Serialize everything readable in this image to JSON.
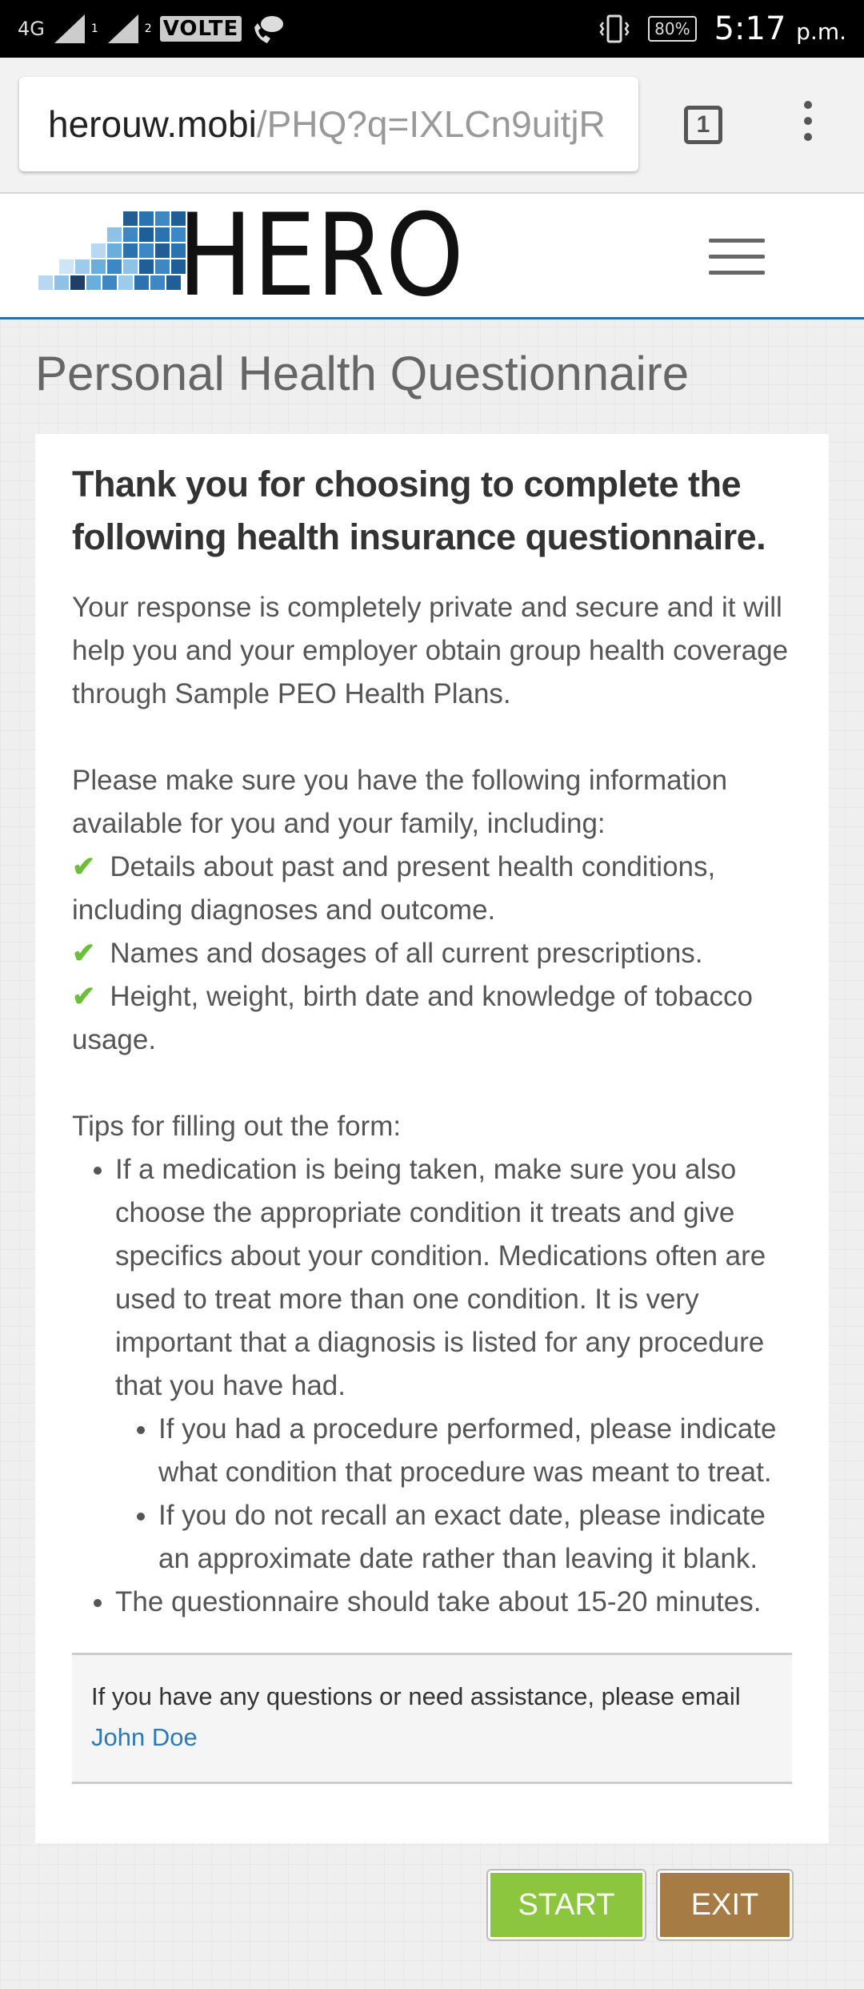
{
  "status_bar": {
    "network": "4G",
    "sim1": "1",
    "sim2": "2",
    "volte": "VOLTE",
    "battery": "80%",
    "time": "5:17",
    "ampm": "p.m."
  },
  "browser": {
    "url_host": "herouw.mobi",
    "url_path": "/PHQ?q=IXLCn9uitjR",
    "tab_count": "1"
  },
  "site": {
    "logo_text": "HERO",
    "brand_color": "#2e6da4"
  },
  "page": {
    "title": "Personal Health Questionnaire"
  },
  "card": {
    "heading": "Thank you for choosing to complete the following health insurance questionnaire.",
    "privacy_text": "Your response is completely private and secure and it will help you and your employer obtain group health coverage through Sample PEO Health Plans.",
    "info_intro": "Please make sure you have the following information available for you and your family, including:",
    "checklist": [
      "Details about past and present health conditions, including diagnoses and outcome.",
      "Names and dosages of all current prescriptions.",
      "Height, weight, birth date and knowledge of tobacco usage."
    ],
    "tips_intro": "Tips for filling out the form:",
    "tips": [
      "If a medication is being taken, make sure you also choose the appropriate condition it treats and give specifics about your condition. Medications often are used to treat more than one condition. It is very important that a diagnosis is listed for any procedure that you have had.",
      "The questionnaire should take about 15-20 minutes."
    ],
    "sub_tips": [
      "If you had a procedure performed, please indicate what condition that procedure was meant to treat.",
      "If you do not recall an exact date, please indicate an approximate date rather than leaving it blank."
    ],
    "help_text": "If you have any questions or need assistance, please email ",
    "help_link": "John Doe"
  },
  "buttons": {
    "start": "START",
    "exit": "EXIT",
    "start_color": "#8cc63f",
    "exit_color": "#a67b44"
  },
  "icons": [
    "signal-icon",
    "vibrate-icon",
    "battery-icon",
    "checkmark-icon",
    "hamburger-menu-icon",
    "overflow-menu-icon"
  ]
}
